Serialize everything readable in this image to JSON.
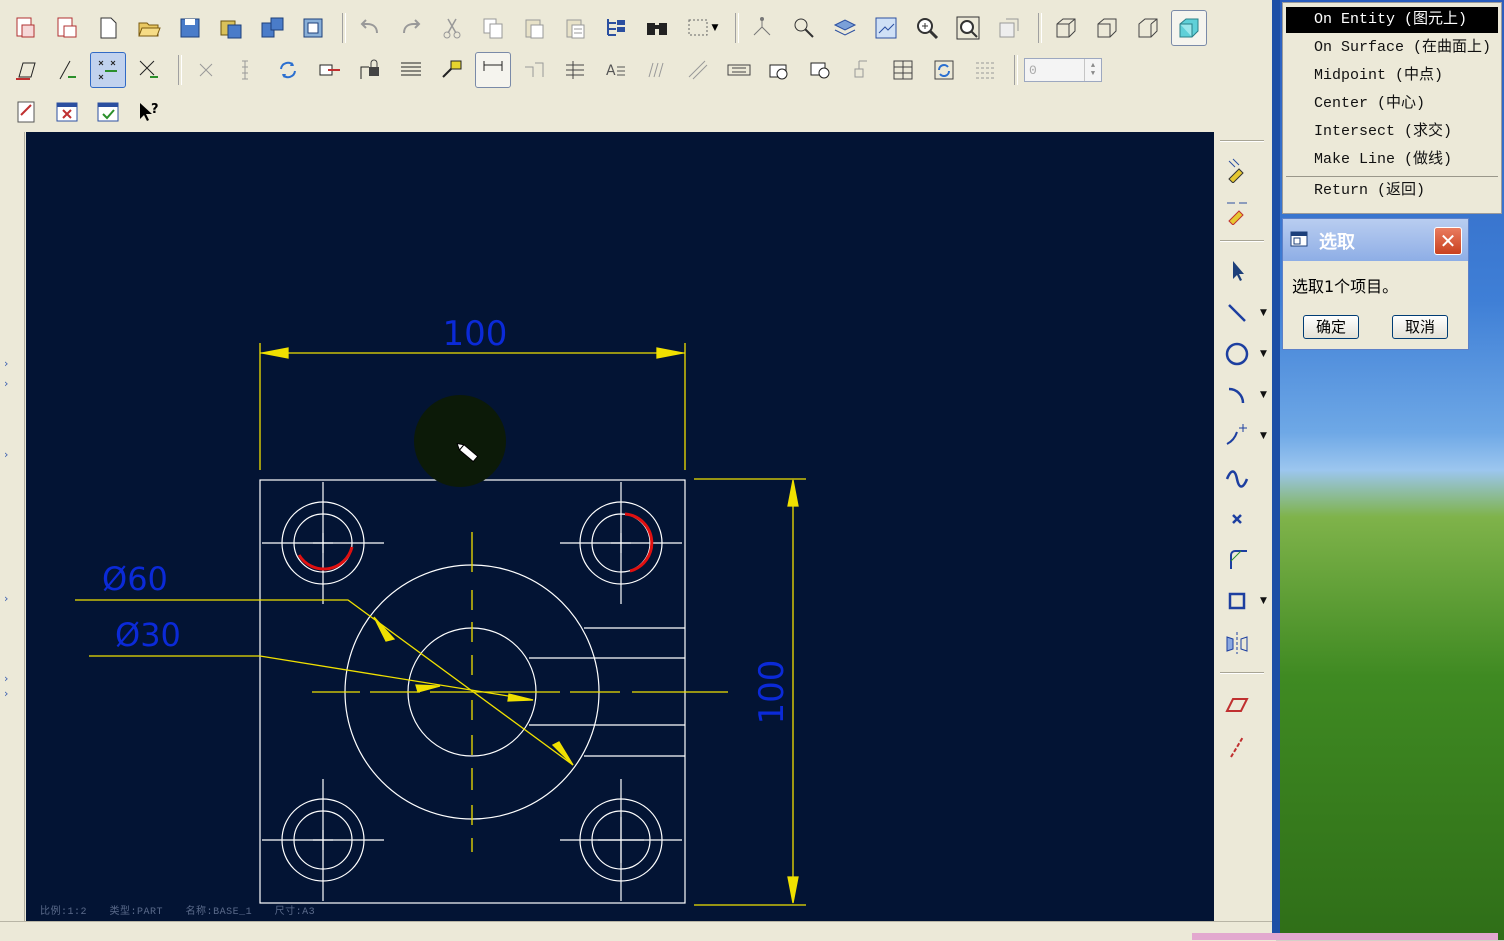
{
  "toolbar": {
    "row1_icons": [
      "plot-in-icon",
      "plot-out-icon",
      "new-file-icon",
      "open-folder-icon",
      "save-icon",
      "save-copy-icon",
      "save-all-icon",
      "backup-icon",
      "undo-icon",
      "redo-icon",
      "cut-icon",
      "copy-icon",
      "paste-icon",
      "paste-special-icon",
      "tree-icon",
      "binoculars-icon",
      "select-box-icon",
      "sketch-tools-icon",
      "magnet-icon",
      "layers-icon",
      "view-window-icon",
      "zoom-in-icon",
      "zoom-fit-icon",
      "orient-icon",
      "iso-view-icon",
      "front-view-icon",
      "side-view-icon",
      "shaded-view-icon"
    ],
    "row2_icons": [
      "erase-icon",
      "draft-line-icon",
      "snap-icon",
      "intersect-icon",
      "delete-icon",
      "column-icon",
      "regen-icon",
      "move-icon",
      "lock-icon",
      "table-icon",
      "highlight-icon",
      "dimension-icon",
      "align-icon",
      "grid-icon",
      "text-icon",
      "hatch-icon",
      "slash-icon",
      "format-icon",
      "view-a-icon",
      "view-b-icon",
      "move-view-icon",
      "table-lines-icon",
      "refresh-table-icon",
      "list-icon"
    ],
    "row2_spin_value": "0",
    "row3_icons": [
      "sheet-edit-icon",
      "close-window-icon",
      "check-window-icon",
      "whats-this-icon"
    ]
  },
  "drawing": {
    "dim_top": "100",
    "dim_right": "100",
    "dim_d60": "Ø60",
    "dim_d30": "Ø30",
    "line_color": "#ffffff",
    "dim_line_color": "#f0e000",
    "dim_text_color": "#0b2ad8",
    "highlight_color": "#e01010",
    "background": "#031434"
  },
  "canvas_status": {
    "scale": "比例:1:2",
    "type": "类型:PART",
    "name": "名称:BASE_1",
    "size": "尺寸:A3"
  },
  "right_toolbar": {
    "icons": [
      "show-annotations-icon",
      "new-annotation-icon",
      "select-arrow-icon",
      "line-icon",
      "circle-icon",
      "arc-icon",
      "point-icon",
      "spline-icon",
      "x-point-icon",
      "fillet-icon",
      "rectangle-icon",
      "mirror-icon",
      "offset-icon",
      "slash-edge-icon"
    ]
  },
  "snap_menu": {
    "items": [
      "On Entity (图元上)",
      "On Surface (在曲面上)",
      "Midpoint (中点)",
      "Center (中心)",
      "Intersect (求交)",
      "Make Line (做线)",
      "Return (返回)"
    ],
    "highlighted_index": 0
  },
  "select_dialog": {
    "title": "选取",
    "message": "选取1个项目。",
    "ok_label": "确定",
    "cancel_label": "取消"
  }
}
